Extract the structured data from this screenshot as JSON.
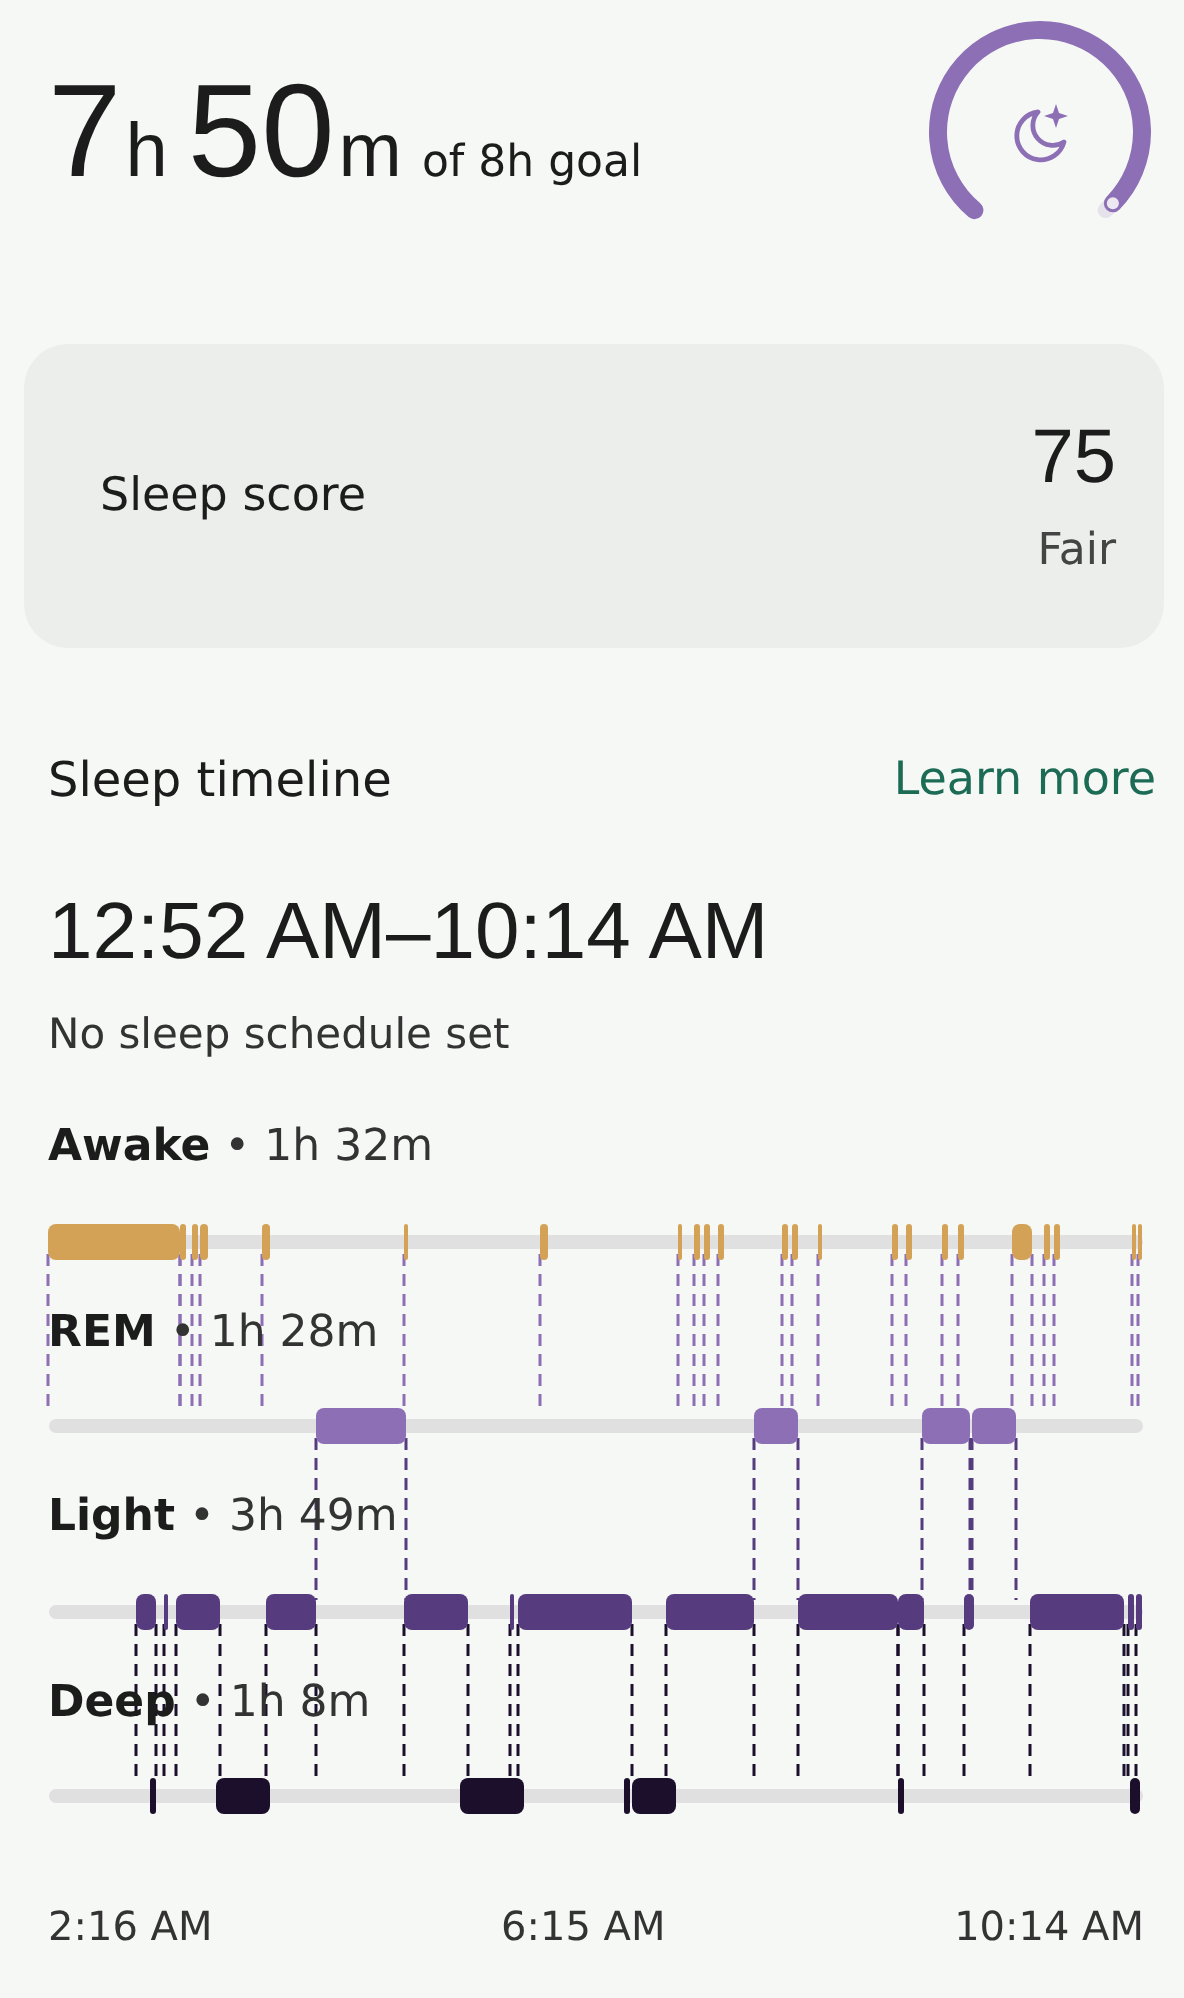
{
  "summary": {
    "hours": "7",
    "hours_unit": "h",
    "minutes": "50",
    "minutes_unit": "m",
    "goal": "of 8h goal"
  },
  "score_card": {
    "label": "Sleep score",
    "score": "75",
    "rating": "Fair"
  },
  "timeline": {
    "title": "Sleep timeline",
    "link": "Learn more",
    "range": "12:52 AM–10:14 AM",
    "schedule": "No sleep schedule set",
    "stages": [
      {
        "name": "Awake",
        "separator": "•",
        "duration": "1h 32m",
        "color": "#d4a257"
      },
      {
        "name": "REM",
        "separator": "•",
        "duration": "1h 28m",
        "color": "#8d6fb5"
      },
      {
        "name": "Light",
        "separator": "•",
        "duration": "3h 49m",
        "color": "#563c7e"
      },
      {
        "name": "Deep",
        "separator": "•",
        "duration": "1h 8m",
        "color": "#1b0f2b"
      }
    ],
    "time_labels": [
      "2:16 AM",
      "6:15 AM",
      "10:14 AM"
    ]
  }
}
